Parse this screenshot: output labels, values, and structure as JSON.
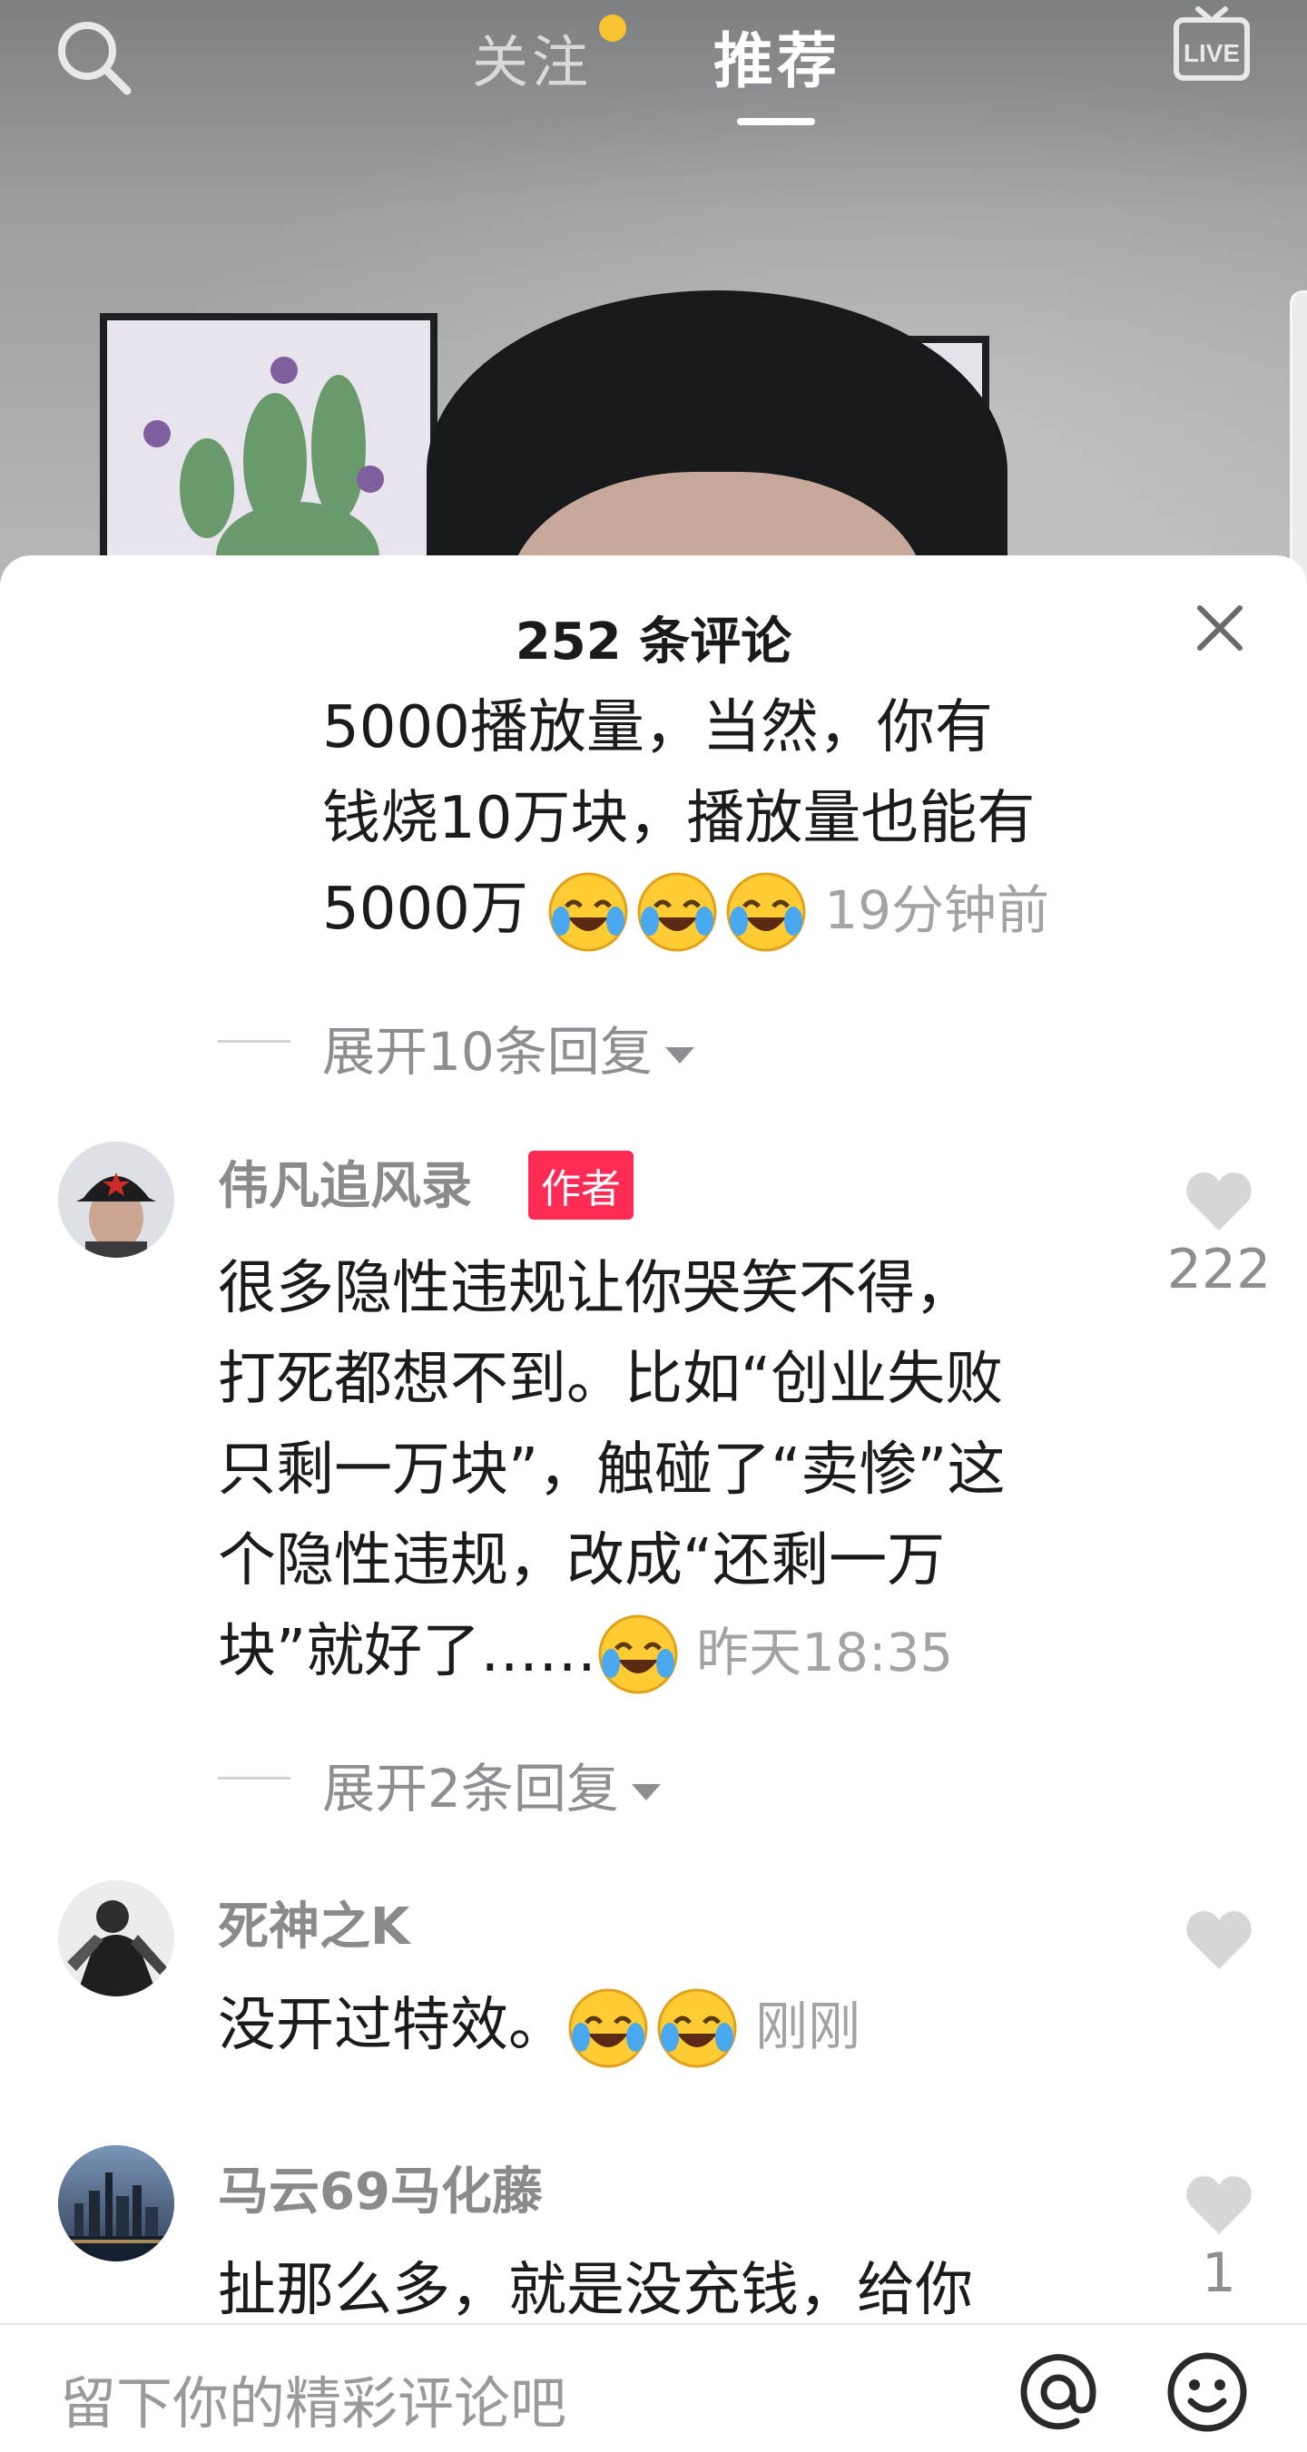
{
  "top_nav": {
    "follow_label": "关注",
    "recommend_label": "推荐",
    "follow_dot_color": "#f7c32e"
  },
  "comments_sheet": {
    "title": "252 条评论",
    "continuation_comment": {
      "lines": [
        "5000播放量，当然，你有",
        "钱烧10万块，播放量也能有",
        "5000万"
      ],
      "emoji_count": 3,
      "time": "19分钟前",
      "expand_label": "展开10条回复"
    },
    "comments": [
      {
        "username": "伟凡追风录",
        "badge": "作者",
        "lines": [
          "很多隐性违规让你哭笑不得，",
          "打死都想不到。比如“创业失败",
          "只剩一万块”，触碰了“卖惨”这",
          "个隐性违规，改成“还剩一万",
          "块”就好了……"
        ],
        "emoji_count": 1,
        "time": "昨天18:35",
        "likes": "222",
        "expand_label": "展开2条回复"
      },
      {
        "username": "死神之K",
        "lines": [
          "没开过特效。"
        ],
        "emoji_count": 2,
        "time": "刚刚",
        "likes": ""
      },
      {
        "username": "马云69马化藤",
        "lines": [
          "扯那么多，就是没充钱，给你"
        ],
        "likes": "1"
      }
    ]
  },
  "input_bar": {
    "placeholder": "留下你的精彩评论吧"
  },
  "colors": {
    "author_badge": "#fe2c55",
    "secondary_text": "#8e8e92"
  }
}
